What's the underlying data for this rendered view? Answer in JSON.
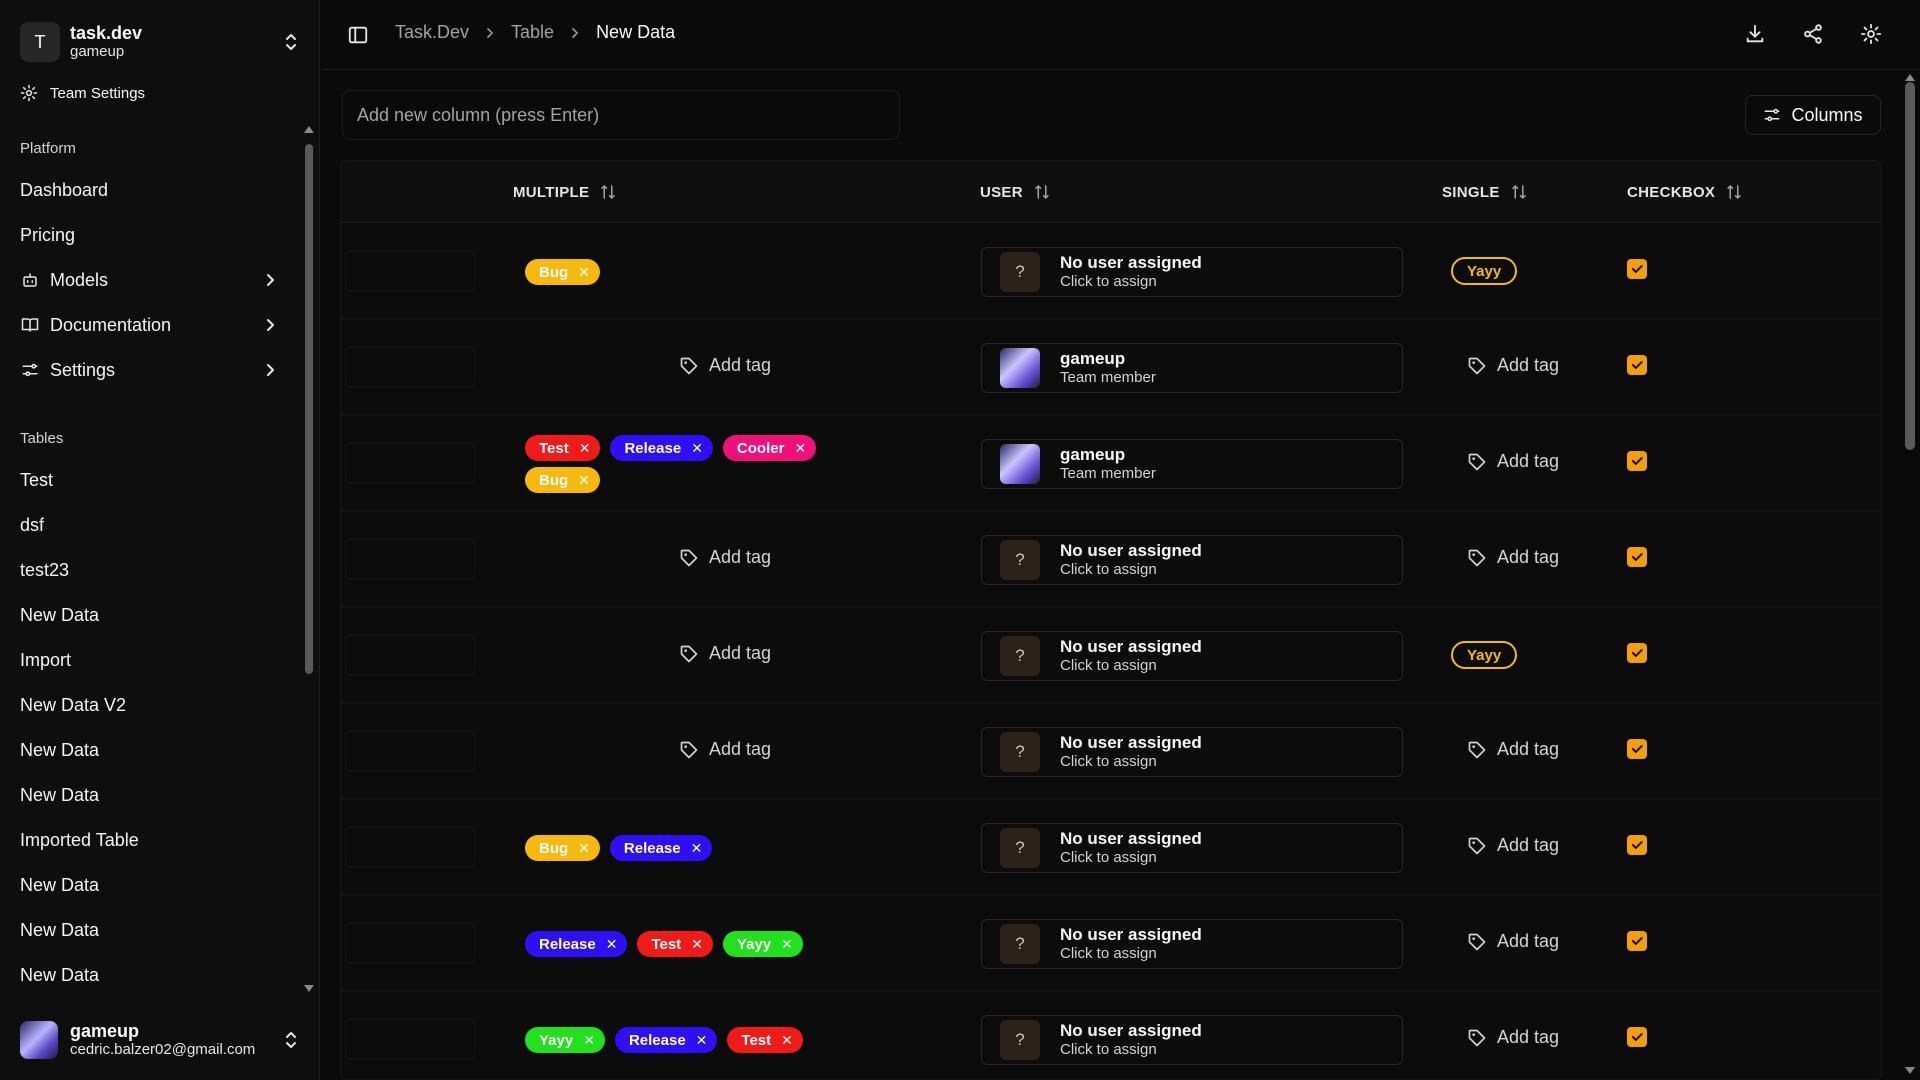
{
  "team": {
    "initial": "T",
    "name": "task.dev",
    "sub": "gameup"
  },
  "team_settings": "Team Settings",
  "sidebar": {
    "platform_label": "Platform",
    "platform_items": [
      {
        "label": "Dashboard",
        "icon": ""
      },
      {
        "label": "Pricing",
        "icon": ""
      },
      {
        "label": "Models",
        "icon": "bot-icon"
      },
      {
        "label": "Documentation",
        "icon": "book-icon"
      },
      {
        "label": "Settings",
        "icon": "sliders-icon"
      }
    ],
    "tables_label": "Tables",
    "tables_items": [
      "Test",
      "dsf",
      "test23",
      "New Data",
      "Import",
      "New Data V2",
      "New Data",
      "New Data",
      "Imported Table",
      "New Data",
      "New Data",
      "New Data"
    ]
  },
  "user": {
    "name": "gameup",
    "email": "cedric.balzer02@gmail.com"
  },
  "breadcrumb": [
    "Task.Dev",
    "Table",
    "New Data"
  ],
  "toolbar": {
    "column_placeholder": "Add new column (press Enter)",
    "columns_label": "Columns"
  },
  "table": {
    "headers": {
      "multiple": "MULTIPLE",
      "user": "USER",
      "single": "SINGLE",
      "checkbox": "CHECKBOX"
    },
    "add_tag_label": "Add tag",
    "no_user": {
      "name": "No user assigned",
      "sub": "Click to assign",
      "glyph": "?"
    },
    "member": {
      "name": "gameup",
      "sub": "Team member"
    },
    "tag_colors": {
      "Bug": "#f5b90f",
      "Test": "#ef1b1b",
      "Release": "#2f10f5",
      "Cooler": "#f0107a",
      "Yayy": "#22e01e"
    },
    "rows": [
      {
        "multi": [
          "Bug"
        ],
        "user": "none",
        "single": "Yayy",
        "checked": true
      },
      {
        "multi": [],
        "user": "member",
        "single": "",
        "checked": true
      },
      {
        "multi": [
          "Test",
          "Release",
          "Cooler",
          "Bug"
        ],
        "user": "member",
        "single": "",
        "checked": true
      },
      {
        "multi": [],
        "user": "none",
        "single": "",
        "checked": true
      },
      {
        "multi": [],
        "user": "none",
        "single": "Yayy",
        "checked": true
      },
      {
        "multi": [],
        "user": "none",
        "single": "",
        "checked": true
      },
      {
        "multi": [
          "Bug",
          "Release"
        ],
        "user": "none",
        "single": "",
        "checked": true
      },
      {
        "multi": [
          "Release",
          "Test",
          "Yayy"
        ],
        "user": "none",
        "single": "",
        "checked": true
      },
      {
        "multi": [
          "Yayy",
          "Release",
          "Test"
        ],
        "user": "none",
        "single": "",
        "checked": true
      }
    ]
  }
}
